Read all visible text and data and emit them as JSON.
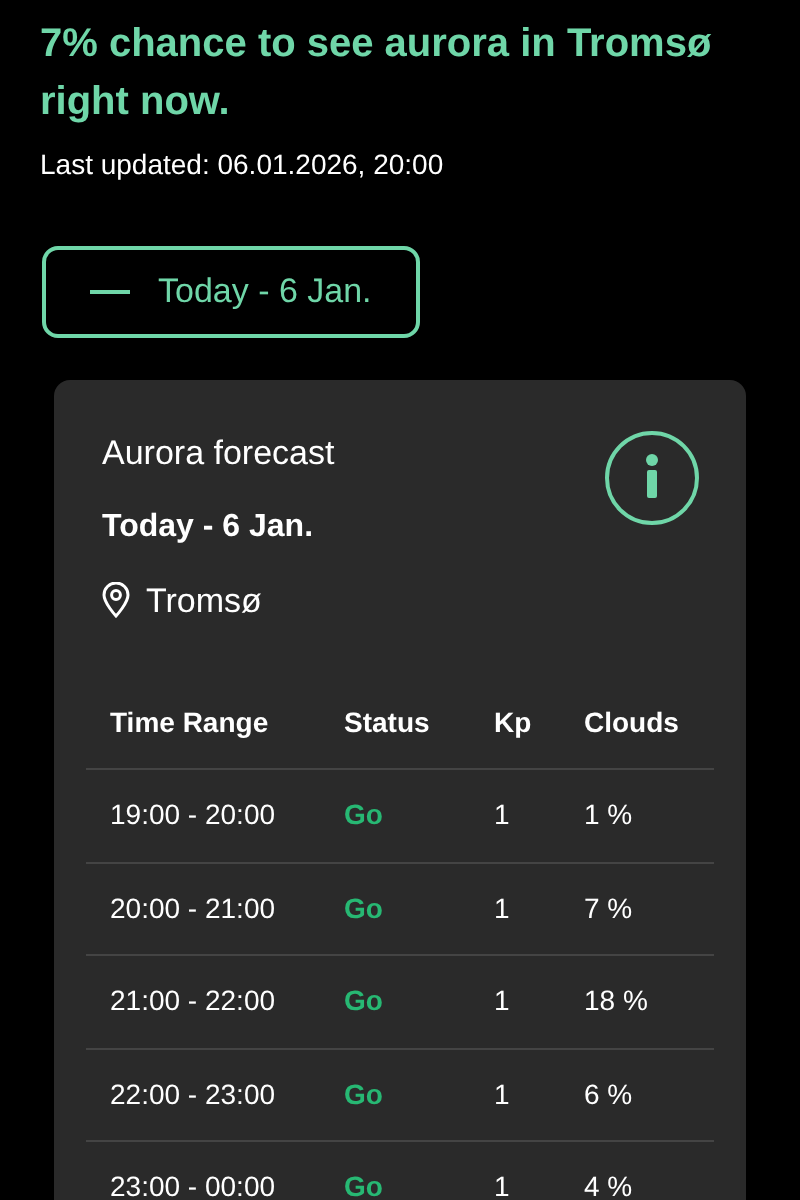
{
  "headline": "7% chance to see aurora in Tromsø right now.",
  "last_updated": "Last updated: 06.01.2026, 20:00",
  "day_button": {
    "label": "Today - 6 Jan.",
    "expanded": true
  },
  "card": {
    "title": "Aurora forecast",
    "date": "Today - 6 Jan.",
    "location": "Tromsø",
    "table": {
      "columns": [
        "Time Range",
        "Status",
        "Kp",
        "Clouds"
      ],
      "rows": [
        {
          "time": "19:00 - 20:00",
          "status": "Go",
          "kind": "go",
          "kp": "1",
          "clouds": "1 %"
        },
        {
          "time": "20:00 - 21:00",
          "status": "Go",
          "kind": "go",
          "kp": "1",
          "clouds": "7 %"
        },
        {
          "time": "21:00 - 22:00",
          "status": "Go",
          "kind": "go",
          "kp": "1",
          "clouds": "18 %"
        },
        {
          "time": "22:00 - 23:00",
          "status": "Go",
          "kind": "go",
          "kp": "1",
          "clouds": "6 %"
        },
        {
          "time": "23:00 - 00:00",
          "status": "Go",
          "kind": "go",
          "kp": "1",
          "clouds": "4 %"
        }
      ]
    }
  }
}
